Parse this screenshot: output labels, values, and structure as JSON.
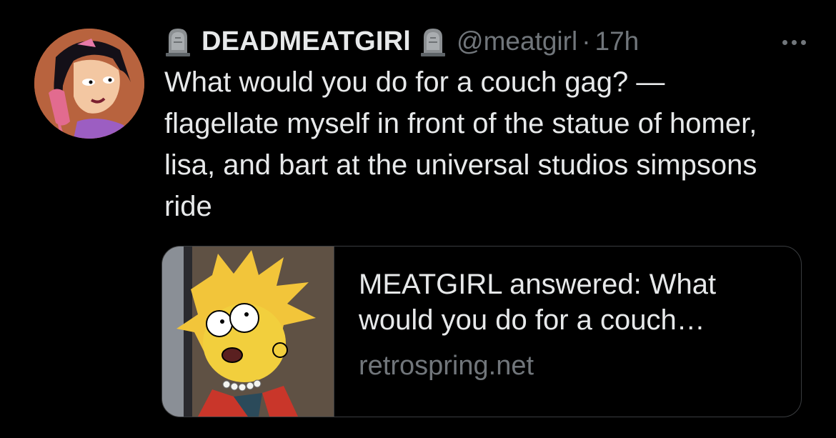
{
  "tweet": {
    "avatar_icon": "avatar-cartoon-girl-on-phone",
    "display_name": "DEADMEATGIRl",
    "badge_icon": "tombstone-icon",
    "handle": "@meatgirl",
    "separator": "·",
    "time": "17h",
    "more_icon": "more-options-icon",
    "text": "What would you do for a couch gag? — flagellate myself in front of the statue of homer, lisa, and bart at the universal studios simpsons ride"
  },
  "card": {
    "thumbnail_icon": "cartoon-character-thumbnail",
    "title": "MEATGIRL answered: What would you do for a couch…",
    "domain": "retrospring.net"
  },
  "colors": {
    "background": "#000000",
    "primary_text": "#e7e9ea",
    "secondary_text": "#71767b",
    "card_border": "#3a3d40"
  }
}
